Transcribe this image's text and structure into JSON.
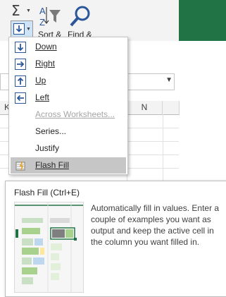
{
  "ribbon": {
    "autosum_icon": "sigma-icon",
    "fill_icon": "fill-down-icon",
    "sort_label": "Sort &",
    "find_label": "Find &"
  },
  "grid": {
    "col_k": "K",
    "col_n": "N"
  },
  "menu": {
    "items": [
      {
        "label": "Down",
        "icon": "arrow-down-icon",
        "enabled": true
      },
      {
        "label": "Right",
        "icon": "arrow-right-icon",
        "enabled": true
      },
      {
        "label": "Up",
        "icon": "arrow-up-icon",
        "enabled": true
      },
      {
        "label": "Left",
        "icon": "arrow-left-icon",
        "enabled": true
      },
      {
        "label": "Across Worksheets...",
        "enabled": false
      },
      {
        "label": "Series...",
        "enabled": true
      },
      {
        "label": "Justify",
        "enabled": true
      },
      {
        "label": "Flash Fill",
        "icon": "flash-fill-icon",
        "enabled": true,
        "highlighted": true
      }
    ]
  },
  "tooltip": {
    "title": "Flash Fill (Ctrl+E)",
    "body": "Automatically fill in values. Enter a couple of examples you want as output and keep the active cell in the column you want filled in."
  },
  "colors": {
    "accent_green": "#217346",
    "icon_blue": "#2b579a",
    "hover_gray": "#c6c6c6"
  }
}
